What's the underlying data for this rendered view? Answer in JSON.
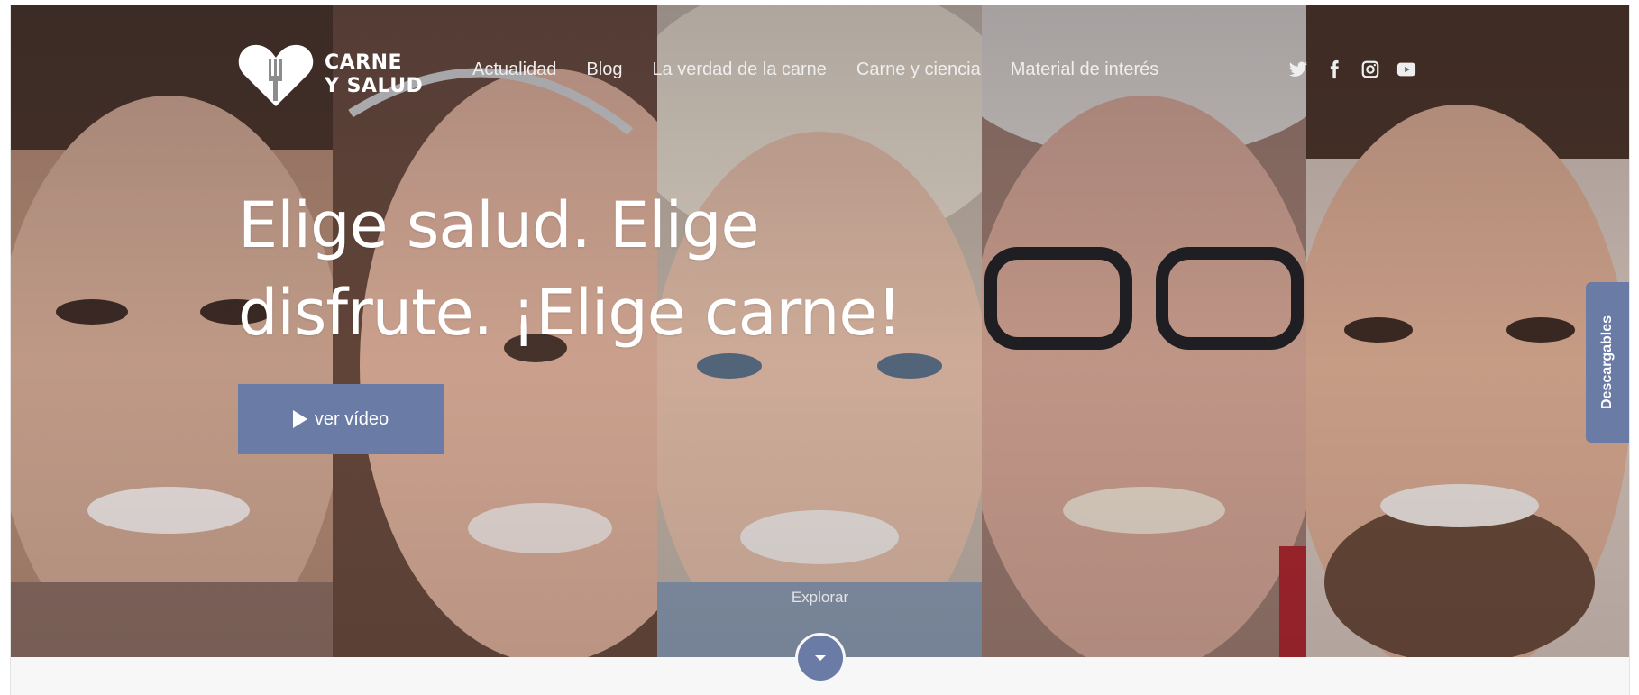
{
  "brand": {
    "line1": "CARNE",
    "line2": "Y SALUD",
    "logo_icon": "heart-fork-icon"
  },
  "nav": {
    "items": [
      {
        "label": "Actualidad"
      },
      {
        "label": "Blog"
      },
      {
        "label": "La verdad de la carne"
      },
      {
        "label": "Carne y ciencia"
      },
      {
        "label": "Material de interés"
      }
    ]
  },
  "social": {
    "icons": [
      "twitter-icon",
      "facebook-icon",
      "instagram-icon",
      "youtube-icon"
    ]
  },
  "hero": {
    "headline": "Elige salud. Elige disfrute. ¡Elige carne!",
    "video_button": "ver vídeo",
    "explore_label": "Explorar"
  },
  "side_tab": {
    "label": "Descargables"
  },
  "colors": {
    "accent": "#6a7ba6",
    "text_light": "#ffffff"
  }
}
